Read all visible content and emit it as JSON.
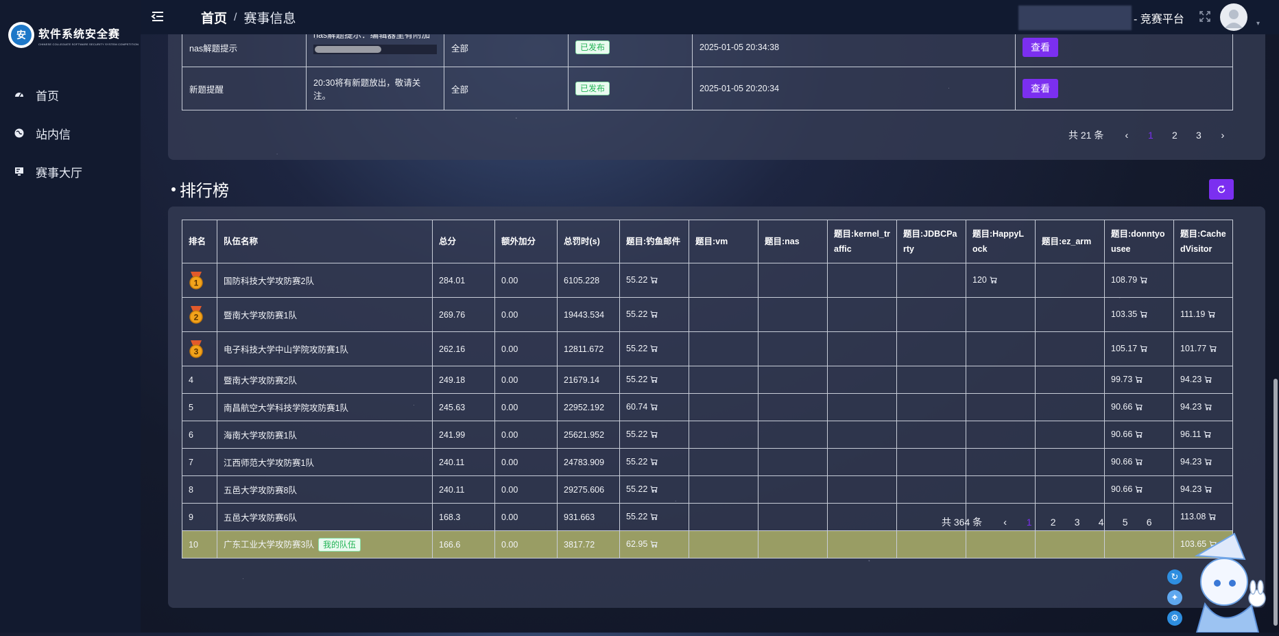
{
  "sidebar": {
    "logo_title": "软件系统安全赛",
    "logo_subtitle": "CHINESE COLLEGIATE SOFTWARE SECURITY SYSTEM COMPETITION",
    "logo_mark": "安",
    "items": [
      {
        "label": "首页",
        "icon": "dashboard-icon"
      },
      {
        "label": "站内信",
        "icon": "globe-icon"
      },
      {
        "label": "赛事大厅",
        "icon": "monitor-icon"
      }
    ]
  },
  "header": {
    "breadcrumb_home": "首页",
    "breadcrumb_sep": "/",
    "breadcrumb_current": "赛事信息",
    "platform_name": "- 竞赛平台",
    "caret": "▾"
  },
  "notices": {
    "rows": [
      {
        "title": "nas解题提示",
        "content": "nas解题提示：编辑器里有附加题",
        "scope": "全部",
        "status": "已发布",
        "time": "2025-01-05 20:34:38",
        "action": "查看",
        "progress": 0.55
      },
      {
        "title": "新题提醒",
        "content": "20:30将有新题放出，敬请关注。",
        "scope": "全部",
        "status": "已发布",
        "time": "2025-01-05 20:20:34",
        "action": "查看"
      }
    ],
    "pager": {
      "total": "共 21 条",
      "pages": [
        "1",
        "2",
        "3"
      ],
      "active": "1",
      "prev": "‹",
      "next": "›"
    }
  },
  "leaderboard": {
    "title": "排行榜",
    "headers": [
      "排名",
      "队伍名称",
      "总分",
      "额外加分",
      "总罚时(s)",
      "题目:钓鱼邮件",
      "题目:vm",
      "题目:nas",
      "题目:kernel_traffic",
      "题目:JDBCParty",
      "题目:HappyLock",
      "题目:ez_arm",
      "题目:donntyousee",
      "题目:CachedVisitor"
    ],
    "rows": [
      {
        "rank": "1",
        "team": "国防科技大学攻防赛2队",
        "score": "284.01",
        "bonus": "0.00",
        "penalty": "6105.228",
        "cells": [
          "55.22",
          "",
          "",
          "",
          "",
          "120",
          "",
          "108.79",
          ""
        ]
      },
      {
        "rank": "2",
        "team": "暨南大学攻防赛1队",
        "score": "269.76",
        "bonus": "0.00",
        "penalty": "19443.534",
        "cells": [
          "55.22",
          "",
          "",
          "",
          "",
          "",
          "",
          "103.35",
          "111.19"
        ]
      },
      {
        "rank": "3",
        "team": "电子科技大学中山学院攻防赛1队",
        "score": "262.16",
        "bonus": "0.00",
        "penalty": "12811.672",
        "cells": [
          "55.22",
          "",
          "",
          "",
          "",
          "",
          "",
          "105.17",
          "101.77"
        ]
      },
      {
        "rank": "4",
        "team": "暨南大学攻防赛2队",
        "score": "249.18",
        "bonus": "0.00",
        "penalty": "21679.14",
        "cells": [
          "55.22",
          "",
          "",
          "",
          "",
          "",
          "",
          "99.73",
          "94.23"
        ]
      },
      {
        "rank": "5",
        "team": "南昌航空大学科技学院攻防赛1队",
        "score": "245.63",
        "bonus": "0.00",
        "penalty": "22952.192",
        "cells": [
          "60.74",
          "",
          "",
          "",
          "",
          "",
          "",
          "90.66",
          "94.23"
        ]
      },
      {
        "rank": "6",
        "team": "海南大学攻防赛1队",
        "score": "241.99",
        "bonus": "0.00",
        "penalty": "25621.952",
        "cells": [
          "55.22",
          "",
          "",
          "",
          "",
          "",
          "",
          "90.66",
          "96.11"
        ]
      },
      {
        "rank": "7",
        "team": "江西师范大学攻防赛1队",
        "score": "240.11",
        "bonus": "0.00",
        "penalty": "24783.909",
        "cells": [
          "55.22",
          "",
          "",
          "",
          "",
          "",
          "",
          "90.66",
          "94.23"
        ]
      },
      {
        "rank": "8",
        "team": "五邑大学攻防赛8队",
        "score": "240.11",
        "bonus": "0.00",
        "penalty": "29275.606",
        "cells": [
          "55.22",
          "",
          "",
          "",
          "",
          "",
          "",
          "90.66",
          "94.23"
        ]
      },
      {
        "rank": "9",
        "team": "五邑大学攻防赛6队",
        "score": "168.3",
        "bonus": "0.00",
        "penalty": "931.663",
        "cells": [
          "55.22",
          "",
          "",
          "",
          "",
          "",
          "",
          "",
          "113.08"
        ]
      },
      {
        "rank": "10",
        "team": "广东工业大学攻防赛3队",
        "score": "166.6",
        "bonus": "0.00",
        "penalty": "3817.72",
        "cells": [
          "62.95",
          "",
          "",
          "",
          "",
          "",
          "",
          "",
          "103.65"
        ],
        "mine": "我的队伍"
      }
    ],
    "pager": {
      "total": "共 364 条",
      "pages": [
        "1",
        "2",
        "3",
        "4",
        "5",
        "6"
      ],
      "active": "1",
      "prev": "‹"
    }
  },
  "colors": {
    "accent": "#7b2ff0",
    "success": "#22b455",
    "sidebar": "#121a2f",
    "header": "#111a30",
    "mine_row": "#a8ac68",
    "medal": "#f2a31b"
  }
}
